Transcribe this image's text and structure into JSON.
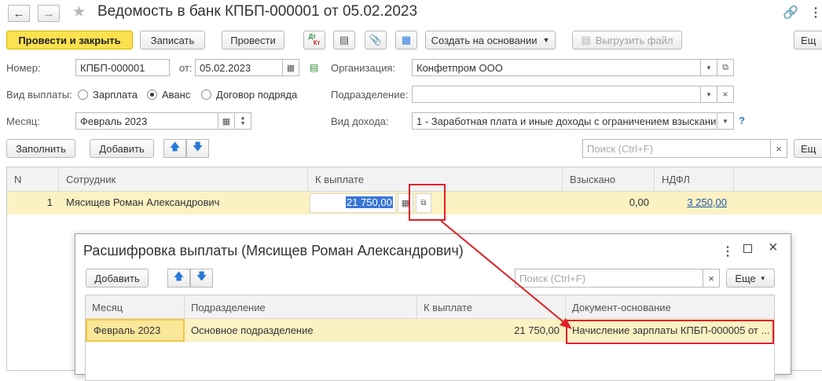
{
  "window": {
    "title": "Ведомость в банк КПБП-000001 от 05.02.2023",
    "back_icon": "arrow-left-icon",
    "forward_icon": "arrow-right-icon",
    "star_icon": "star-icon"
  },
  "toolbar": {
    "post_close": "Провести и закрыть",
    "save": "Записать",
    "post": "Провести",
    "dtkt_dt": "Дт",
    "dtkt_kt": "Кт",
    "create_based": "Создать на основании",
    "export_file": "Выгрузить файл",
    "more": "Ещ"
  },
  "form": {
    "number_label": "Номер:",
    "number_value": "КПБП-000001",
    "date_label": "от:",
    "date_value": "05.02.2023",
    "org_label": "Организация:",
    "org_value": "Конфетпром ООО",
    "payment_type_label": "Вид выплаты:",
    "payment_options": [
      "Зарплата",
      "Аванс",
      "Договор подряда"
    ],
    "payment_selected": "Аванс",
    "division_label": "Подразделение:",
    "division_value": "",
    "month_label": "Месяц:",
    "month_value": "Февраль 2023",
    "income_label": "Вид дохода:",
    "income_value": "1 - Заработная плата и иные доходы с ограничением взыскани",
    "help": "?"
  },
  "table_toolbar": {
    "fill": "Заполнить",
    "add": "Добавить",
    "search_placeholder": "Поиск (Ctrl+F)",
    "clear": "×",
    "more": "Ещ"
  },
  "table": {
    "columns": [
      "N",
      "Сотрудник",
      "К выплате",
      "Взыскано",
      "НДФЛ"
    ],
    "rows": [
      {
        "n": "1",
        "employee": "Мясищев Роман Александрович",
        "payout": "21 750,00",
        "collected": "0,00",
        "ndfl": "3 250,00"
      }
    ]
  },
  "dialog": {
    "title": "Расшифровка выплаты (Мясищев Роман Александрович)",
    "add": "Добавить",
    "search_placeholder": "Поиск (Ctrl+F)",
    "clear": "×",
    "more": "Еще",
    "columns": [
      "Месяц",
      "Подразделение",
      "К выплате",
      "Документ-основание"
    ],
    "rows": [
      {
        "month": "Февраль 2023",
        "division": "Основное подразделение",
        "payout": "21 750,00",
        "document": "Начисление зарплаты КПБП-000005 от ..."
      }
    ]
  },
  "colors": {
    "primary_button": "#fbe14e",
    "row_highlight": "#fbf1c3",
    "annotation": "#e21f26",
    "link": "#2258a8"
  }
}
